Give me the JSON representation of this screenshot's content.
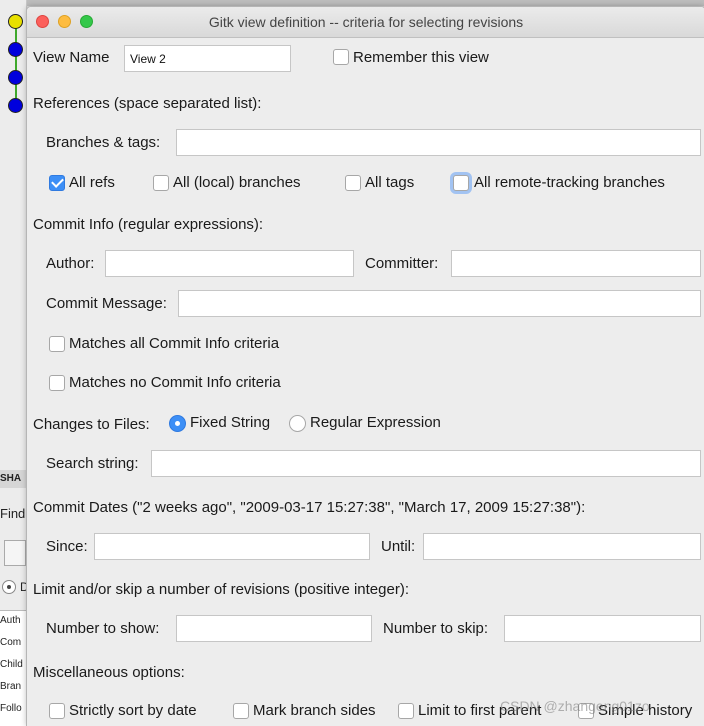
{
  "window": {
    "title": "Gitk view definition -- criteria for selecting revisions"
  },
  "background": {
    "sha_label": "SHA",
    "find_label": "Find",
    "radio_label": "D",
    "info_labels": [
      "Auth",
      "Com",
      "Child",
      "Bran",
      "Follo"
    ]
  },
  "view": {
    "name_label": "View Name",
    "name_value": "View 2",
    "remember_label": "Remember this view",
    "remember_checked": false
  },
  "references": {
    "heading": "References (space separated list):",
    "branches_label": "Branches & tags:",
    "branches_value": "",
    "all_refs_label": "All refs",
    "all_refs_checked": true,
    "all_local_label": "All (local) branches",
    "all_tags_label": "All tags",
    "all_remote_label": "All remote-tracking branches"
  },
  "commit_info": {
    "heading": "Commit Info (regular expressions):",
    "author_label": "Author:",
    "committer_label": "Committer:",
    "message_label": "Commit Message:",
    "match_all_label": "Matches all Commit Info criteria",
    "match_none_label": "Matches no Commit Info criteria"
  },
  "changes": {
    "label": "Changes to Files:",
    "fixed_label": "Fixed String",
    "regex_label": "Regular Expression",
    "selected": "Fixed String",
    "search_label": "Search string:"
  },
  "dates": {
    "heading": "Commit Dates (\"2 weeks ago\", \"2009-03-17 15:27:38\", \"March 17, 2009 15:27:38\"):",
    "since_label": "Since:",
    "until_label": "Until:"
  },
  "limit": {
    "heading": "Limit and/or skip a number of revisions (positive integer):",
    "show_label": "Number to show:",
    "skip_label": "Number to skip:"
  },
  "misc": {
    "heading": "Miscellaneous options:",
    "sort_label": "Strictly sort by date",
    "mark_label": "Mark branch sides",
    "first_parent_label": "Limit to first parent",
    "simple_label": "Simple history"
  },
  "watermark": "CSDN @zhangeng01zo",
  "colors": {
    "accent": "#3d8ff6",
    "commit_head": "#e8e000",
    "commit_node": "#0000dd",
    "graph_line": "#3ea82b"
  }
}
